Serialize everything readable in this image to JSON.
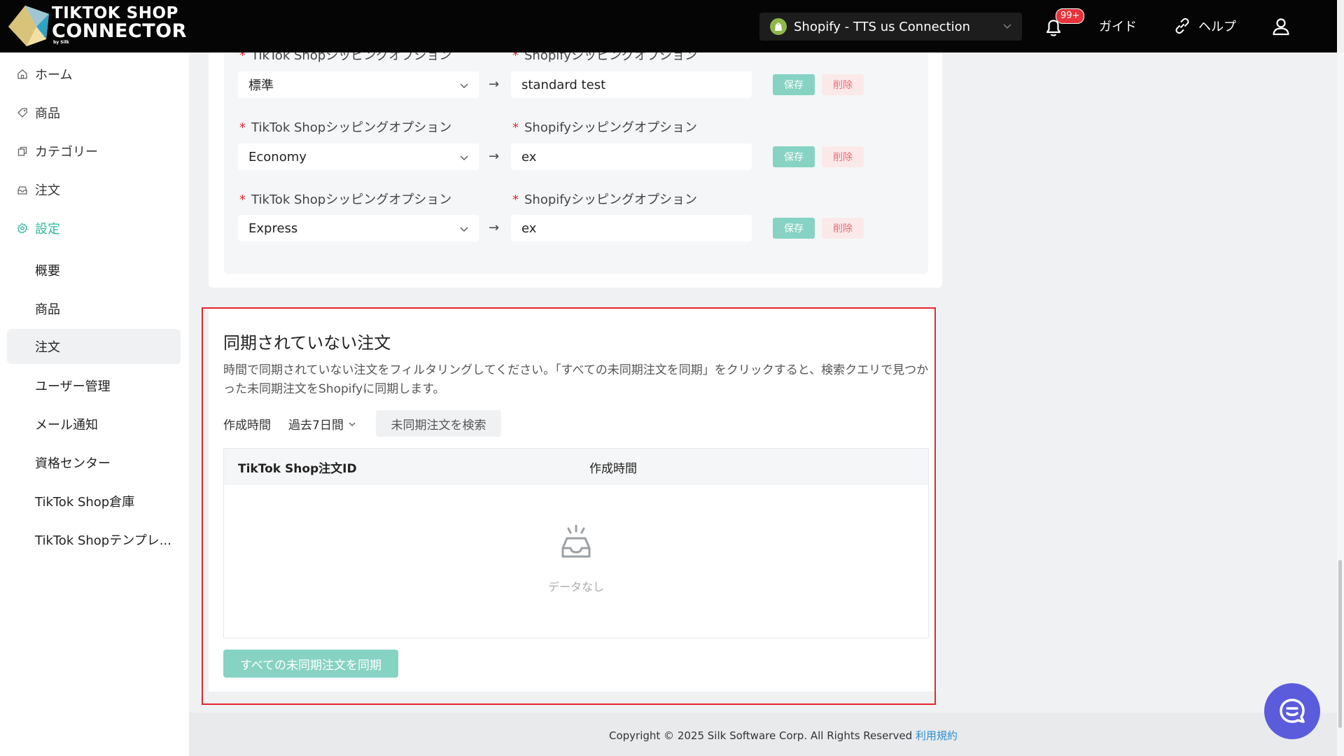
{
  "header": {
    "logo_line1": "TIKTOK SHOP",
    "logo_line2": "CONNECTOR",
    "logo_by": "by Silk",
    "store_name": "Shopify - TTS us Connection",
    "notification_badge": "99+",
    "guide": "ガイド",
    "help": "ヘルプ"
  },
  "sidebar": {
    "items": [
      {
        "label": "ホーム",
        "icon": "home-icon"
      },
      {
        "label": "商品",
        "icon": "tag-icon"
      },
      {
        "label": "カテゴリー",
        "icon": "copy-icon"
      },
      {
        "label": "注文",
        "icon": "inbox-icon"
      },
      {
        "label": "設定",
        "icon": "gear-icon"
      }
    ],
    "sub_items": [
      "概要",
      "商品",
      "注文",
      "ユーザー管理",
      "メール通知",
      "資格センター",
      "TikTok Shop倉庫",
      "TikTok Shopテンプレ..."
    ]
  },
  "shipping": {
    "tts_label": "TikTok Shopシッピングオプション",
    "shopify_label": "Shopifyシッピングオプション",
    "save_label": "保存",
    "delete_label": "削除",
    "arrow": "→",
    "rows": [
      {
        "tts": "標準",
        "shopify": "standard test"
      },
      {
        "tts": "Economy",
        "shopify": "ex"
      },
      {
        "tts": "Express",
        "shopify": "ex"
      }
    ]
  },
  "unsynced": {
    "title": "同期されていない注文",
    "description": "時間で同期されていない注文をフィルタリングしてください。「すべての未同期注文を同期」をクリックすると、検索クエリで見つかった未同期注文をShopifyに同期します。",
    "filter_label": "作成時間",
    "filter_value": "過去7日間",
    "search_button": "未同期注文を検索",
    "columns": [
      "TikTok Shop注文ID",
      "作成時間"
    ],
    "empty_text": "データなし",
    "sync_button": "すべての未同期注文を同期"
  },
  "footer": {
    "copyright": "Copyright © 2025 Silk Software Corp. All Rights Reserved",
    "terms": "利用規約"
  },
  "colors": {
    "accent": "#2fb79b",
    "save_button": "#86d3c3",
    "delete_text": "#e86c74",
    "highlight_border": "#e4262e",
    "chat_bubble": "#5a5cdc"
  }
}
